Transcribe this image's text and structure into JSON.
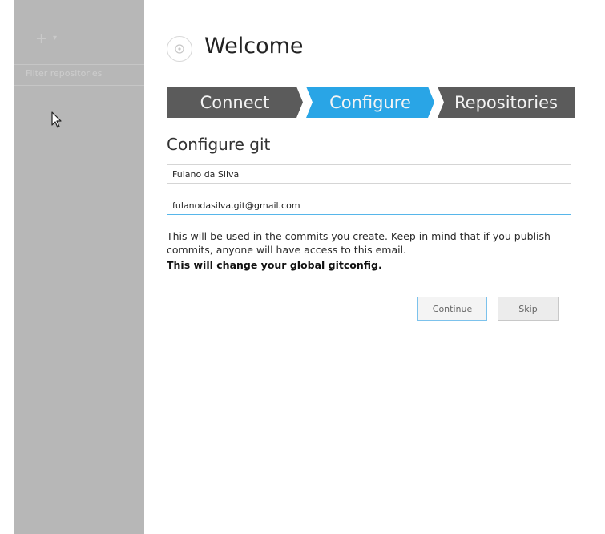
{
  "sidebar": {
    "add_label": "+",
    "add_caret": "▾",
    "filter_placeholder": "Filter repositories"
  },
  "header": {
    "icon": "github-octocat-icon",
    "title": "Welcome"
  },
  "steps": [
    {
      "label": "Connect",
      "active": false
    },
    {
      "label": "Configure",
      "active": true
    },
    {
      "label": "Repositories",
      "active": false
    }
  ],
  "form": {
    "section_title": "Configure git",
    "name_value": "Fulano da Silva",
    "email_value": "fulanodasilva.git@gmail.com",
    "help_text": "This will be used in the commits you create. Keep in mind that if you publish commits, anyone will have access to this email.",
    "warning_text": "This will change your global gitconfig.",
    "continue_label": "Continue",
    "skip_label": "Skip"
  },
  "colors": {
    "accent": "#29a5e6",
    "step_inactive": "#5b5b5b",
    "sidebar_bg": "#b7b7b7"
  }
}
